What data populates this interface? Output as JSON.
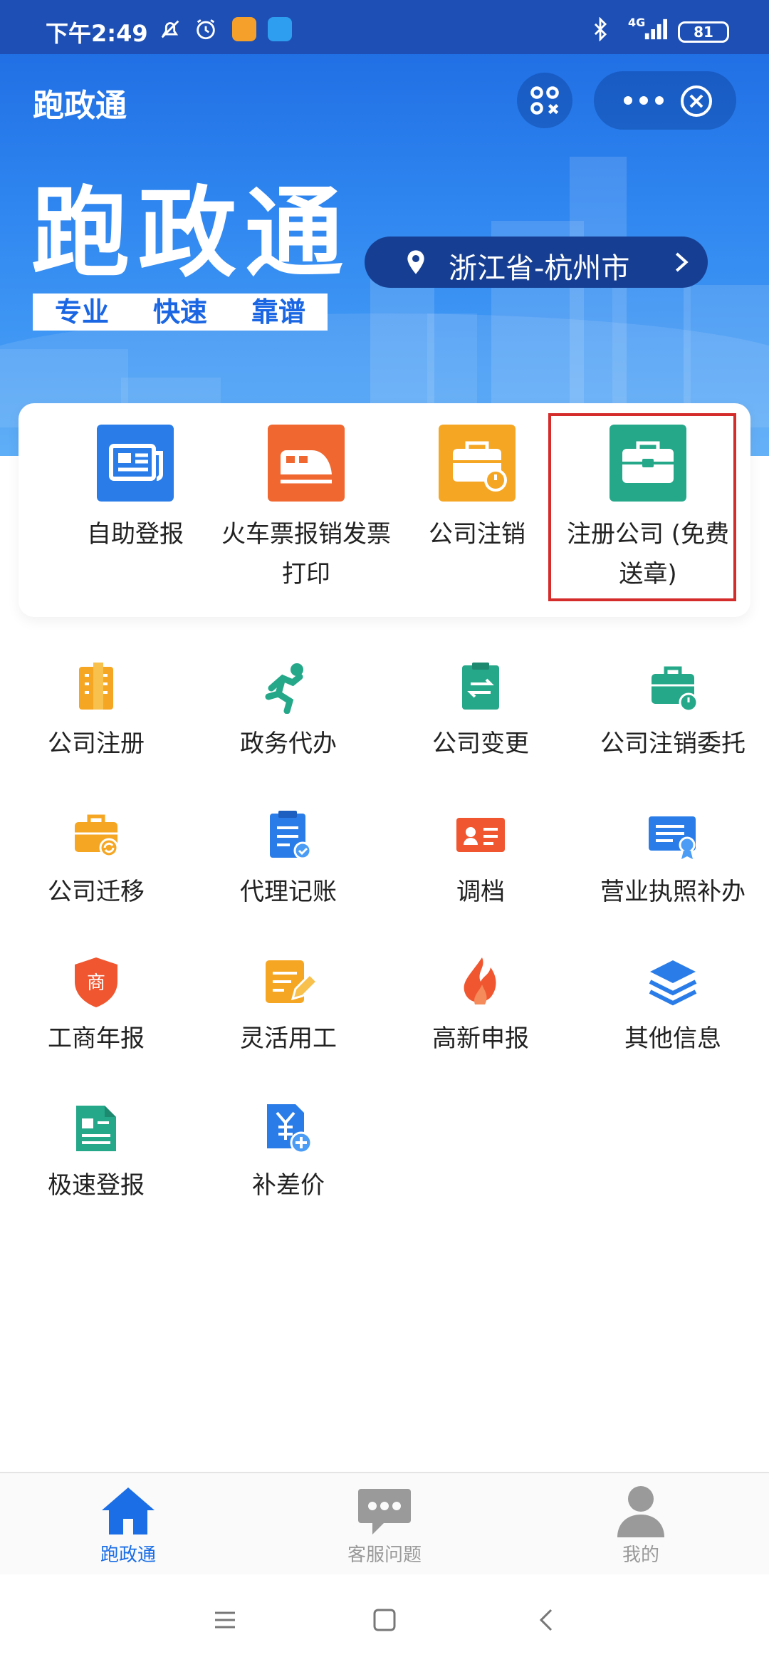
{
  "status_bar": {
    "time": "下午2:49",
    "network": "4G",
    "battery": "81",
    "icons": [
      "mute-icon",
      "alarm-icon",
      "app-notification-icon",
      "app-notification-icon",
      "bluetooth-icon",
      "signal-icon",
      "battery-icon"
    ]
  },
  "header": {
    "title": "跑政通",
    "buttons": [
      "qr-scan-icon",
      "more-icon",
      "close-icon"
    ]
  },
  "banner": {
    "brand": "跑政通",
    "tags": [
      "专业",
      "快速",
      "靠谱"
    ],
    "location": "浙江省-杭州市"
  },
  "featured": [
    {
      "label": "自助登报",
      "icon": "newspaper-icon",
      "color": "#2a7ce8"
    },
    {
      "label": "火车票报销发票打印",
      "icon": "train-icon",
      "color": "#f0672f"
    },
    {
      "label": "公司注销",
      "icon": "briefcase-power-icon",
      "color": "#f5a623"
    },
    {
      "label": "注册公司 (免费送章)",
      "icon": "briefcase-icon",
      "color": "#25a889",
      "highlighted": true
    }
  ],
  "services": [
    {
      "label": "公司注册",
      "icon": "building-icon",
      "color": "#f5a623"
    },
    {
      "label": "政务代办",
      "icon": "runner-icon",
      "color": "#25a889"
    },
    {
      "label": "公司变更",
      "icon": "clipboard-swap-icon",
      "color": "#25a889"
    },
    {
      "label": "公司注销委托",
      "icon": "briefcase-power-icon",
      "color": "#25a889"
    },
    {
      "label": "公司迁移",
      "icon": "briefcase-refresh-icon",
      "color": "#f5a623"
    },
    {
      "label": "代理记账",
      "icon": "clipboard-check-icon",
      "color": "#2a7ce8"
    },
    {
      "label": "调档",
      "icon": "id-card-icon",
      "color": "#f0562f"
    },
    {
      "label": "营业执照补办",
      "icon": "certificate-icon",
      "color": "#2a7ce8"
    },
    {
      "label": "工商年报",
      "icon": "shield-badge-icon",
      "color": "#f0562f"
    },
    {
      "label": "灵活用工",
      "icon": "edit-note-icon",
      "color": "#f5a623"
    },
    {
      "label": "高新申报",
      "icon": "flame-icon",
      "color": "#f0562f"
    },
    {
      "label": "其他信息",
      "icon": "layers-icon",
      "color": "#2a7ce8"
    },
    {
      "label": "极速登报",
      "icon": "document-icon",
      "color": "#25a889"
    },
    {
      "label": "补差价",
      "icon": "yen-add-icon",
      "color": "#2a7ce8"
    }
  ],
  "tabbar": {
    "items": [
      {
        "label": "跑政通",
        "icon": "home-icon",
        "active": true
      },
      {
        "label": "客服问题",
        "icon": "chat-bubble-icon",
        "active": false
      },
      {
        "label": "我的",
        "icon": "user-icon",
        "active": false
      }
    ],
    "active_color": "#1b6ee6",
    "inactive_color": "#9a9a9a"
  },
  "navbar": {
    "buttons": [
      "menu-icon",
      "home-square-icon",
      "back-icon"
    ]
  }
}
